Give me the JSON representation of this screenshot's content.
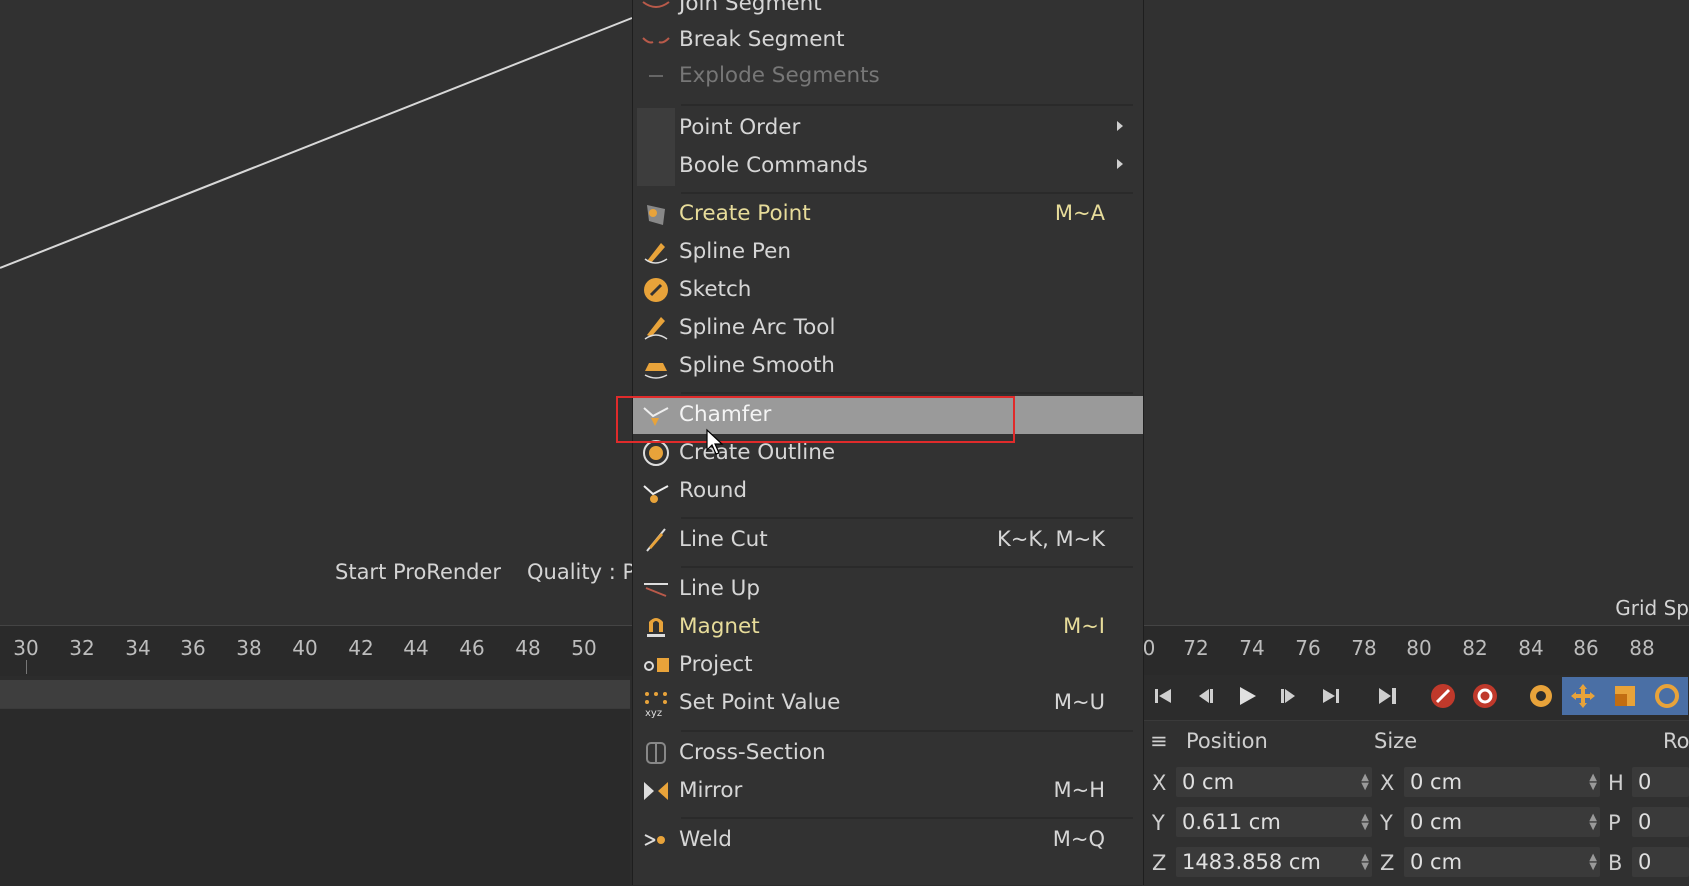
{
  "viewport": {
    "start_prorender": "Start ProRender",
    "quality": "Quality : P",
    "grid_label": "Grid Sp"
  },
  "timeline": {
    "left_ticks": [
      "30",
      "32",
      "34",
      "36",
      "38",
      "40",
      "42",
      "44",
      "46",
      "48",
      "50"
    ],
    "right_ticks": [
      "0",
      "72",
      "74",
      "76",
      "78",
      "80",
      "82",
      "84",
      "86",
      "88"
    ]
  },
  "menu": {
    "items": [
      {
        "label": "Join Segment",
        "shortcut": "",
        "icon": "join-segment-icon"
      },
      {
        "label": "Break Segment",
        "shortcut": "",
        "icon": "break-segment-icon"
      },
      {
        "label": "Explode Segments",
        "shortcut": "",
        "icon": "explode-segments-icon"
      },
      {
        "label": "Point Order",
        "shortcut": "",
        "icon": ""
      },
      {
        "label": "Boole Commands",
        "shortcut": "",
        "icon": ""
      },
      {
        "label": "Create Point",
        "shortcut": "M~A",
        "icon": "create-point-icon"
      },
      {
        "label": "Spline Pen",
        "shortcut": "",
        "icon": "spline-pen-icon"
      },
      {
        "label": "Sketch",
        "shortcut": "",
        "icon": "sketch-icon"
      },
      {
        "label": "Spline Arc Tool",
        "shortcut": "",
        "icon": "spline-arc-icon"
      },
      {
        "label": "Spline Smooth",
        "shortcut": "",
        "icon": "spline-smooth-icon"
      },
      {
        "label": "Chamfer",
        "shortcut": "",
        "icon": "chamfer-icon"
      },
      {
        "label": "Create Outline",
        "shortcut": "",
        "icon": "create-outline-icon"
      },
      {
        "label": "Round",
        "shortcut": "",
        "icon": "round-icon"
      },
      {
        "label": "Line Cut",
        "shortcut": "K~K, M~K",
        "icon": "line-cut-icon"
      },
      {
        "label": "Line Up",
        "shortcut": "",
        "icon": "line-up-icon"
      },
      {
        "label": "Magnet",
        "shortcut": "M~I",
        "icon": "magnet-icon"
      },
      {
        "label": "Project",
        "shortcut": "",
        "icon": "project-icon"
      },
      {
        "label": "Set Point Value",
        "shortcut": "M~U",
        "icon": "set-point-value-icon"
      },
      {
        "label": "Cross-Section",
        "shortcut": "",
        "icon": "cross-section-icon"
      },
      {
        "label": "Mirror",
        "shortcut": "M~H",
        "icon": "mirror-icon"
      },
      {
        "label": "Weld",
        "shortcut": "M~Q",
        "icon": "weld-icon"
      }
    ]
  },
  "coords": {
    "position_label": "Position",
    "size_label": "Size",
    "rotation_label": "Ro",
    "rows": [
      {
        "axis": "X",
        "position": "0 cm",
        "size_axis": "X",
        "size": "0 cm",
        "rot_axis": "H",
        "rot": "0"
      },
      {
        "axis": "Y",
        "position": "0.611 cm",
        "size_axis": "Y",
        "size": "0 cm",
        "rot_axis": "P",
        "rot": "0"
      },
      {
        "axis": "Z",
        "position": "1483.858 cm",
        "size_axis": "Z",
        "size": "0 cm",
        "rot_axis": "B",
        "rot": "0"
      }
    ]
  },
  "colors": {
    "highlight_border": "#e02b2b",
    "selected_row": "#9a9a9a",
    "accent_text": "#e7dc9a",
    "icon_orange": "#e8a33a"
  }
}
